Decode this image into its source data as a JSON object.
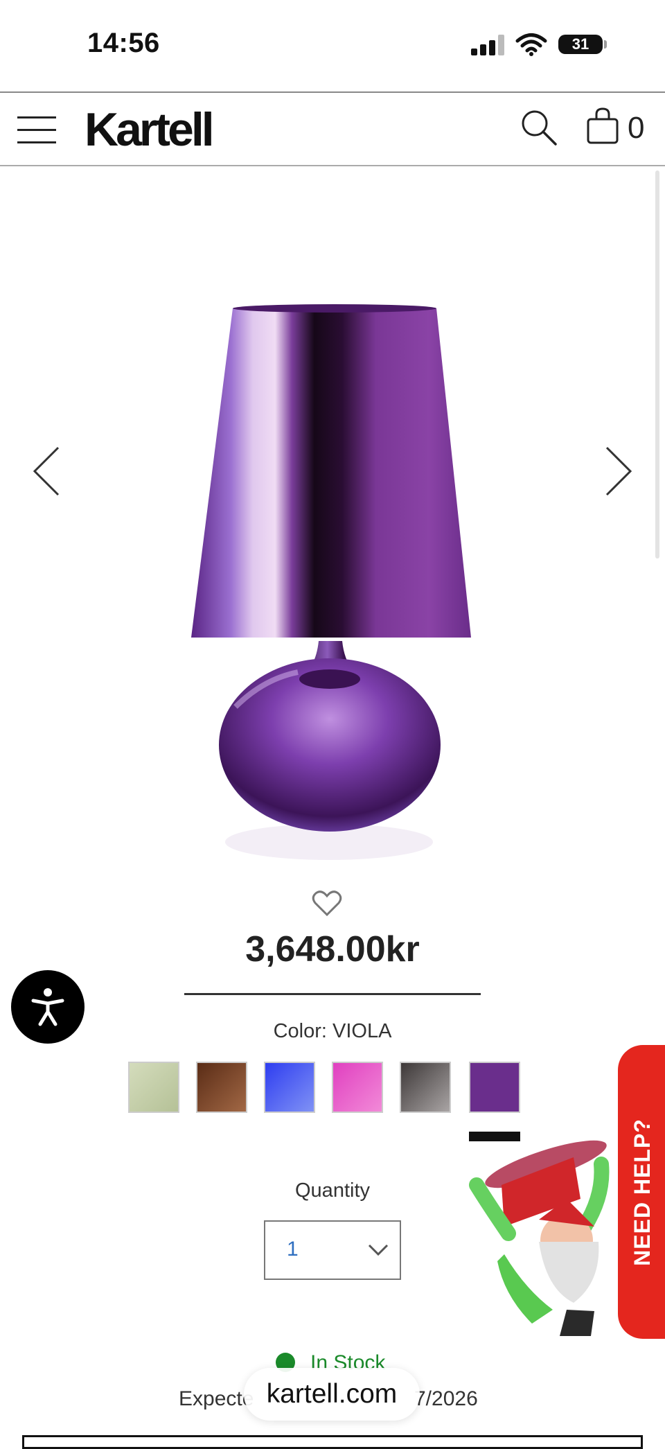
{
  "status_bar": {
    "time": "14:56",
    "battery": "31"
  },
  "header": {
    "logo": "Kartell",
    "cart_count": "0",
    "icons": [
      "menu-icon",
      "search-icon",
      "bag-icon"
    ]
  },
  "product": {
    "price": "3,648.00kr",
    "color_label": "Color: VIOLA",
    "swatches": [
      {
        "color": "#c7d2aa"
      },
      {
        "color": "#7a4228"
      },
      {
        "color": "#4a5cf0"
      },
      {
        "color": "#e860c8"
      },
      {
        "color": "#6b6666"
      },
      {
        "color": "#6a2e8c",
        "selected": true
      }
    ],
    "quantity_label": "Quantity",
    "quantity_value": "1",
    "stock_status": "In Stock",
    "expected_prefix": "Expecte",
    "expected_suffix": "7/2026"
  },
  "browser": {
    "url": "kartell.com"
  },
  "help": {
    "label": "NEED HELP?"
  },
  "colors": {
    "accent_red": "#e4261e",
    "stock_green": "#1a8a2a",
    "product_violet": "#6a2e8c"
  }
}
